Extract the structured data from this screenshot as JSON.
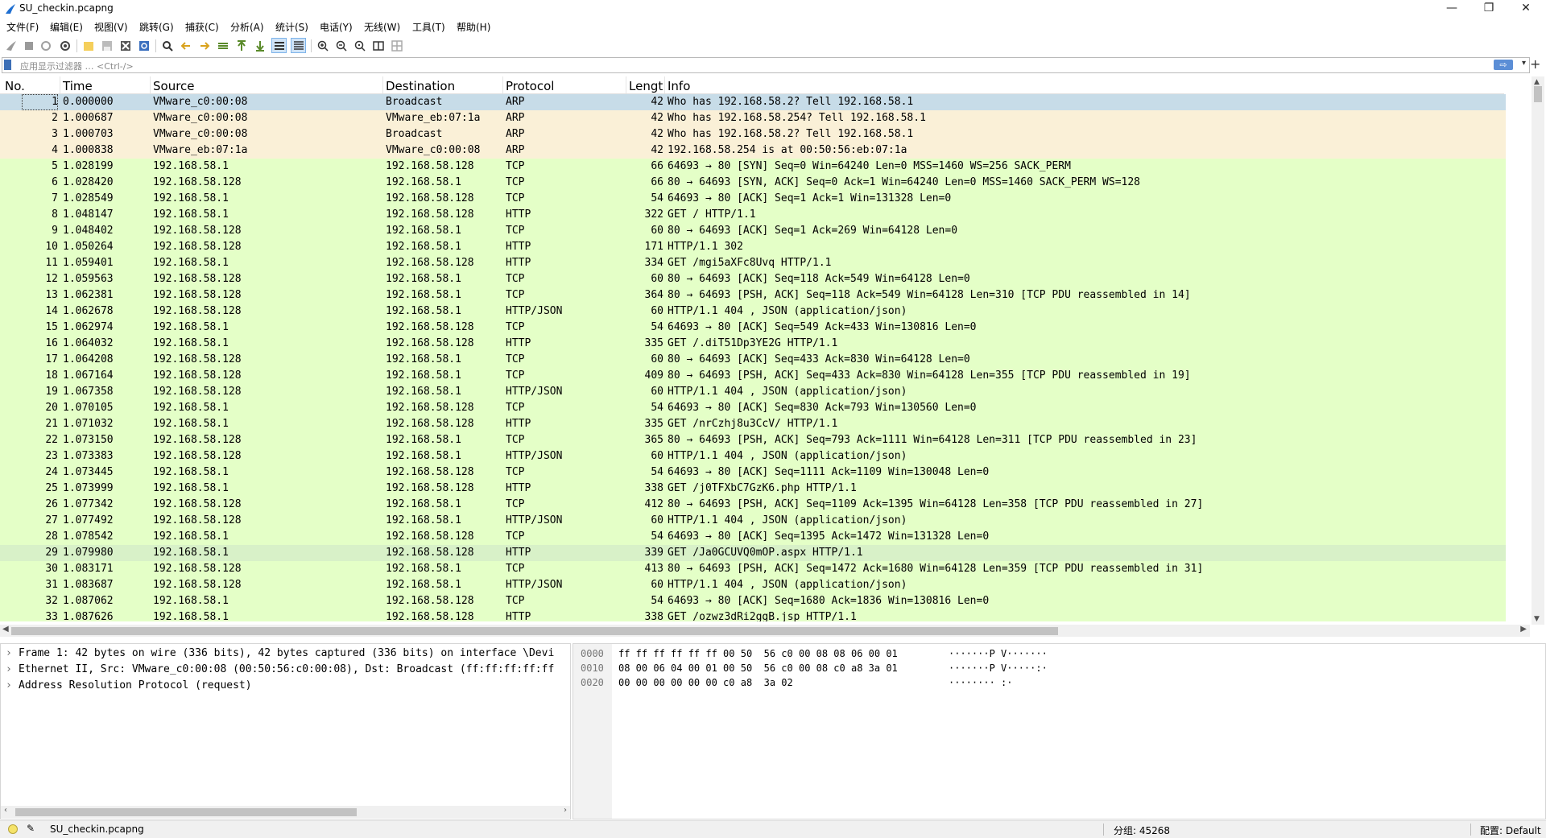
{
  "window": {
    "title": "SU_checkin.pcapng",
    "minimize_glyph": "—",
    "restore_glyph": "❐",
    "close_glyph": "✕"
  },
  "menu": [
    "文件(F)",
    "编辑(E)",
    "视图(V)",
    "跳转(G)",
    "捕获(C)",
    "分析(A)",
    "统计(S)",
    "电话(Y)",
    "无线(W)",
    "工具(T)",
    "帮助(H)"
  ],
  "filter": {
    "placeholder": "应用显示过滤器 … <Ctrl-/>",
    "apply_glyph": "⇨",
    "dropdown_glyph": "▾",
    "add_glyph": "+"
  },
  "columns": [
    "No.",
    "Time",
    "Source",
    "Destination",
    "Protocol",
    "Lengt",
    "Info"
  ],
  "colors": {
    "arp_row": "#faf0d7",
    "tcp_row": "#e4ffc7",
    "selected_row": "#c7dce8",
    "highlight_row": "#d8f1c8"
  },
  "packets": [
    {
      "no": "1",
      "time": "0.000000",
      "src": "VMware_c0:00:08",
      "dst": "Broadcast",
      "proto": "ARP",
      "len": "42",
      "info": "Who has 192.168.58.2? Tell 192.168.58.1",
      "kind": "selected"
    },
    {
      "no": "2",
      "time": "1.000687",
      "src": "VMware_c0:00:08",
      "dst": "VMware_eb:07:1a",
      "proto": "ARP",
      "len": "42",
      "info": "Who has 192.168.58.254? Tell 192.168.58.1",
      "kind": "arp"
    },
    {
      "no": "3",
      "time": "1.000703",
      "src": "VMware_c0:00:08",
      "dst": "Broadcast",
      "proto": "ARP",
      "len": "42",
      "info": "Who has 192.168.58.2? Tell 192.168.58.1",
      "kind": "arp"
    },
    {
      "no": "4",
      "time": "1.000838",
      "src": "VMware_eb:07:1a",
      "dst": "VMware_c0:00:08",
      "proto": "ARP",
      "len": "42",
      "info": "192.168.58.254 is at 00:50:56:eb:07:1a",
      "kind": "arp"
    },
    {
      "no": "5",
      "time": "1.028199",
      "src": "192.168.58.1",
      "dst": "192.168.58.128",
      "proto": "TCP",
      "len": "66",
      "info": "64693 → 80 [SYN] Seq=0 Win=64240 Len=0 MSS=1460 WS=256 SACK_PERM",
      "kind": "tcp"
    },
    {
      "no": "6",
      "time": "1.028420",
      "src": "192.168.58.128",
      "dst": "192.168.58.1",
      "proto": "TCP",
      "len": "66",
      "info": "80 → 64693 [SYN, ACK] Seq=0 Ack=1 Win=64240 Len=0 MSS=1460 SACK_PERM WS=128",
      "kind": "tcp"
    },
    {
      "no": "7",
      "time": "1.028549",
      "src": "192.168.58.1",
      "dst": "192.168.58.128",
      "proto": "TCP",
      "len": "54",
      "info": "64693 → 80 [ACK] Seq=1 Ack=1 Win=131328 Len=0",
      "kind": "tcp"
    },
    {
      "no": "8",
      "time": "1.048147",
      "src": "192.168.58.1",
      "dst": "192.168.58.128",
      "proto": "HTTP",
      "len": "322",
      "info": "GET / HTTP/1.1",
      "kind": "tcp"
    },
    {
      "no": "9",
      "time": "1.048402",
      "src": "192.168.58.128",
      "dst": "192.168.58.1",
      "proto": "TCP",
      "len": "60",
      "info": "80 → 64693 [ACK] Seq=1 Ack=269 Win=64128 Len=0",
      "kind": "tcp"
    },
    {
      "no": "10",
      "time": "1.050264",
      "src": "192.168.58.128",
      "dst": "192.168.58.1",
      "proto": "HTTP",
      "len": "171",
      "info": "HTTP/1.1 302",
      "kind": "tcp"
    },
    {
      "no": "11",
      "time": "1.059401",
      "src": "192.168.58.1",
      "dst": "192.168.58.128",
      "proto": "HTTP",
      "len": "334",
      "info": "GET /mgi5aXFc8Uvq HTTP/1.1",
      "kind": "tcp"
    },
    {
      "no": "12",
      "time": "1.059563",
      "src": "192.168.58.128",
      "dst": "192.168.58.1",
      "proto": "TCP",
      "len": "60",
      "info": "80 → 64693 [ACK] Seq=118 Ack=549 Win=64128 Len=0",
      "kind": "tcp"
    },
    {
      "no": "13",
      "time": "1.062381",
      "src": "192.168.58.128",
      "dst": "192.168.58.1",
      "proto": "TCP",
      "len": "364",
      "info": "80 → 64693 [PSH, ACK] Seq=118 Ack=549 Win=64128 Len=310 [TCP PDU reassembled in 14]",
      "kind": "tcp"
    },
    {
      "no": "14",
      "time": "1.062678",
      "src": "192.168.58.128",
      "dst": "192.168.58.1",
      "proto": "HTTP/JSON",
      "len": "60",
      "info": "HTTP/1.1 404  , JSON (application/json)",
      "kind": "tcp"
    },
    {
      "no": "15",
      "time": "1.062974",
      "src": "192.168.58.1",
      "dst": "192.168.58.128",
      "proto": "TCP",
      "len": "54",
      "info": "64693 → 80 [ACK] Seq=549 Ack=433 Win=130816 Len=0",
      "kind": "tcp"
    },
    {
      "no": "16",
      "time": "1.064032",
      "src": "192.168.58.1",
      "dst": "192.168.58.128",
      "proto": "HTTP",
      "len": "335",
      "info": "GET /.diT51Dp3YE2G HTTP/1.1",
      "kind": "tcp"
    },
    {
      "no": "17",
      "time": "1.064208",
      "src": "192.168.58.128",
      "dst": "192.168.58.1",
      "proto": "TCP",
      "len": "60",
      "info": "80 → 64693 [ACK] Seq=433 Ack=830 Win=64128 Len=0",
      "kind": "tcp"
    },
    {
      "no": "18",
      "time": "1.067164",
      "src": "192.168.58.128",
      "dst": "192.168.58.1",
      "proto": "TCP",
      "len": "409",
      "info": "80 → 64693 [PSH, ACK] Seq=433 Ack=830 Win=64128 Len=355 [TCP PDU reassembled in 19]",
      "kind": "tcp"
    },
    {
      "no": "19",
      "time": "1.067358",
      "src": "192.168.58.128",
      "dst": "192.168.58.1",
      "proto": "HTTP/JSON",
      "len": "60",
      "info": "HTTP/1.1 404  , JSON (application/json)",
      "kind": "tcp"
    },
    {
      "no": "20",
      "time": "1.070105",
      "src": "192.168.58.1",
      "dst": "192.168.58.128",
      "proto": "TCP",
      "len": "54",
      "info": "64693 → 80 [ACK] Seq=830 Ack=793 Win=130560 Len=0",
      "kind": "tcp"
    },
    {
      "no": "21",
      "time": "1.071032",
      "src": "192.168.58.1",
      "dst": "192.168.58.128",
      "proto": "HTTP",
      "len": "335",
      "info": "GET /nrCzhj8u3CcV/ HTTP/1.1",
      "kind": "tcp"
    },
    {
      "no": "22",
      "time": "1.073150",
      "src": "192.168.58.128",
      "dst": "192.168.58.1",
      "proto": "TCP",
      "len": "365",
      "info": "80 → 64693 [PSH, ACK] Seq=793 Ack=1111 Win=64128 Len=311 [TCP PDU reassembled in 23]",
      "kind": "tcp"
    },
    {
      "no": "23",
      "time": "1.073383",
      "src": "192.168.58.128",
      "dst": "192.168.58.1",
      "proto": "HTTP/JSON",
      "len": "60",
      "info": "HTTP/1.1 404  , JSON (application/json)",
      "kind": "tcp"
    },
    {
      "no": "24",
      "time": "1.073445",
      "src": "192.168.58.1",
      "dst": "192.168.58.128",
      "proto": "TCP",
      "len": "54",
      "info": "64693 → 80 [ACK] Seq=1111 Ack=1109 Win=130048 Len=0",
      "kind": "tcp"
    },
    {
      "no": "25",
      "time": "1.073999",
      "src": "192.168.58.1",
      "dst": "192.168.58.128",
      "proto": "HTTP",
      "len": "338",
      "info": "GET /j0TFXbC7GzK6.php HTTP/1.1",
      "kind": "tcp"
    },
    {
      "no": "26",
      "time": "1.077342",
      "src": "192.168.58.128",
      "dst": "192.168.58.1",
      "proto": "TCP",
      "len": "412",
      "info": "80 → 64693 [PSH, ACK] Seq=1109 Ack=1395 Win=64128 Len=358 [TCP PDU reassembled in 27]",
      "kind": "tcp"
    },
    {
      "no": "27",
      "time": "1.077492",
      "src": "192.168.58.128",
      "dst": "192.168.58.1",
      "proto": "HTTP/JSON",
      "len": "60",
      "info": "HTTP/1.1 404  , JSON (application/json)",
      "kind": "tcp"
    },
    {
      "no": "28",
      "time": "1.078542",
      "src": "192.168.58.1",
      "dst": "192.168.58.128",
      "proto": "TCP",
      "len": "54",
      "info": "64693 → 80 [ACK] Seq=1395 Ack=1472 Win=131328 Len=0",
      "kind": "tcp"
    },
    {
      "no": "29",
      "time": "1.079980",
      "src": "192.168.58.1",
      "dst": "192.168.58.128",
      "proto": "HTTP",
      "len": "339",
      "info": "GET /Ja0GCUVQ0mOP.aspx HTTP/1.1",
      "kind": "highlight"
    },
    {
      "no": "30",
      "time": "1.083171",
      "src": "192.168.58.128",
      "dst": "192.168.58.1",
      "proto": "TCP",
      "len": "413",
      "info": "80 → 64693 [PSH, ACK] Seq=1472 Ack=1680 Win=64128 Len=359 [TCP PDU reassembled in 31]",
      "kind": "tcp"
    },
    {
      "no": "31",
      "time": "1.083687",
      "src": "192.168.58.128",
      "dst": "192.168.58.1",
      "proto": "HTTP/JSON",
      "len": "60",
      "info": "HTTP/1.1 404  , JSON (application/json)",
      "kind": "tcp"
    },
    {
      "no": "32",
      "time": "1.087062",
      "src": "192.168.58.1",
      "dst": "192.168.58.128",
      "proto": "TCP",
      "len": "54",
      "info": "64693 → 80 [ACK] Seq=1680 Ack=1836 Win=130816 Len=0",
      "kind": "tcp"
    },
    {
      "no": "33",
      "time": "1.087626",
      "src": "192.168.58.1",
      "dst": "192.168.58.128",
      "proto": "HTTP",
      "len": "338",
      "info": "GET /ozwz3dRi2ggB.jsp HTTP/1.1",
      "kind": "tcp"
    }
  ],
  "details": [
    "Frame 1: 42 bytes on wire (336 bits), 42 bytes captured (336 bits) on interface \\Devi",
    "Ethernet II, Src: VMware_c0:00:08 (00:50:56:c0:00:08), Dst: Broadcast (ff:ff:ff:ff:ff",
    "Address Resolution Protocol (request)"
  ],
  "bytes": [
    {
      "off": "0000",
      "hex": "ff ff ff ff ff ff 00 50  56 c0 00 08 08 06 00 01",
      "ascii": "·······P V·······"
    },
    {
      "off": "0010",
      "hex": "08 00 06 04 00 01 00 50  56 c0 00 08 c0 a8 3a 01",
      "ascii": "·······P V·····:·"
    },
    {
      "off": "0020",
      "hex": "00 00 00 00 00 00 c0 a8  3a 02",
      "ascii": "········ :·"
    }
  ],
  "status": {
    "file": "SU_checkin.pcapng",
    "packets": "分组: 45268",
    "profile": "配置: Default"
  }
}
